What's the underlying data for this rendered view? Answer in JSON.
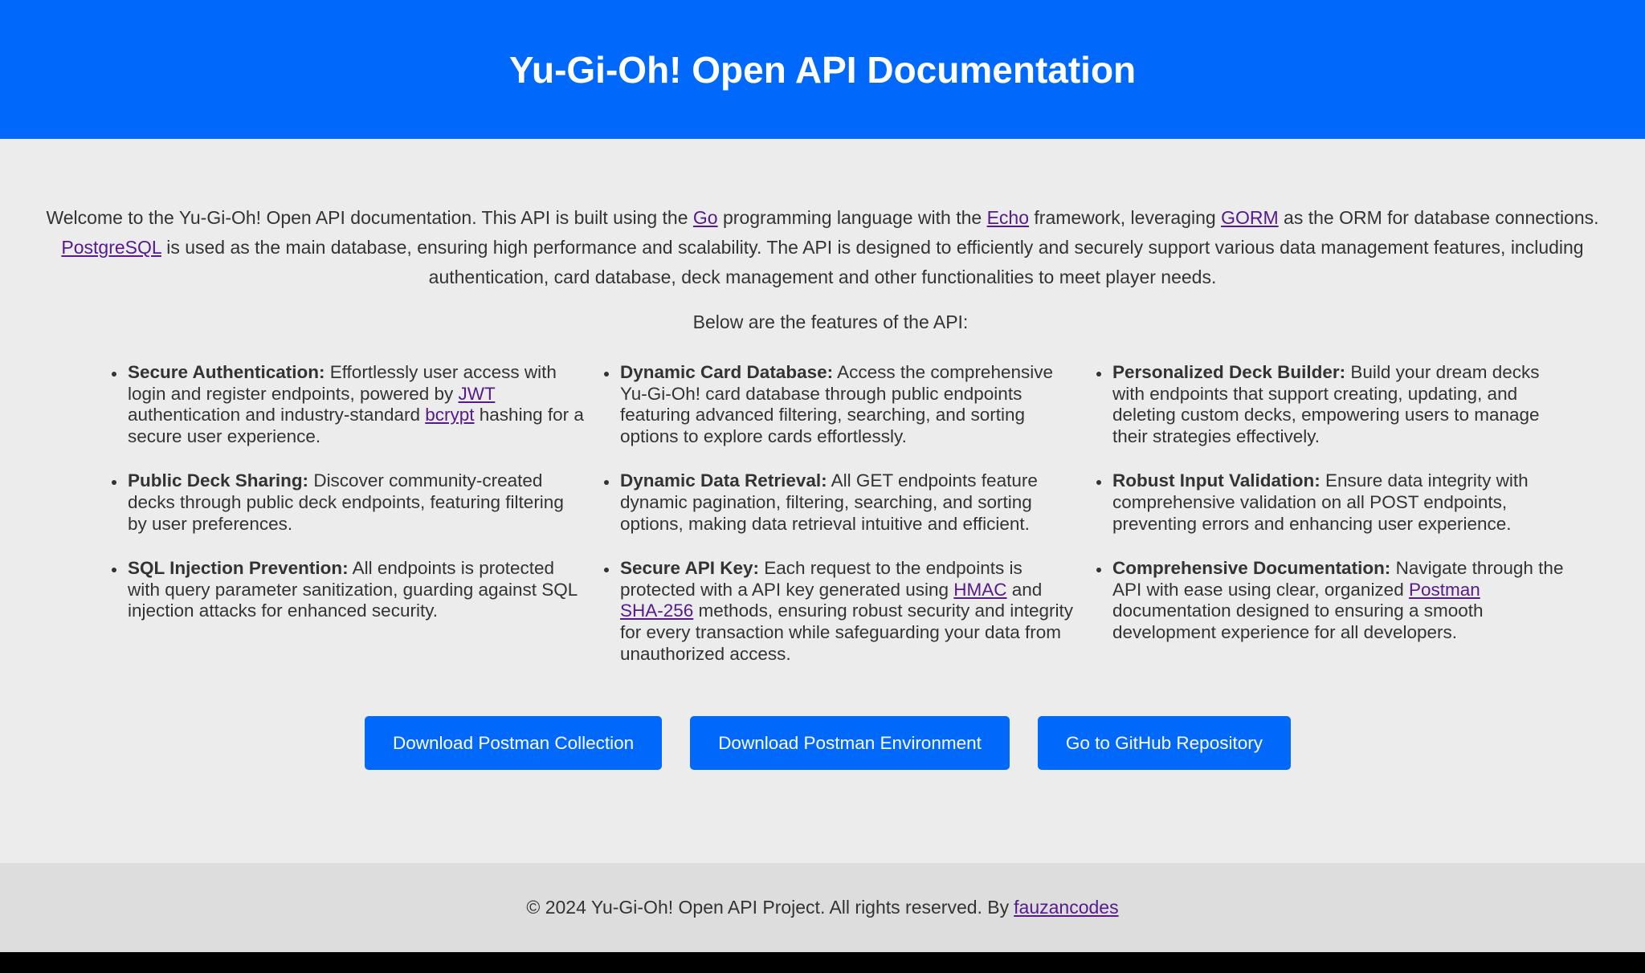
{
  "header": {
    "title": "Yu-Gi-Oh! Open API Documentation"
  },
  "intro": {
    "t1": "Welcome to the Yu-Gi-Oh! Open API documentation. This API is built using the ",
    "go_link": "Go",
    "t2": " programming language with the ",
    "echo_link": "Echo",
    "t3": " framework, leveraging ",
    "gorm_link": "GORM",
    "t4": " as the ORM for database connections. ",
    "postgres_link": "PostgreSQL",
    "t5": " is used as the main database, ensuring high performance and scalability. The API is designed to efficiently and securely support various data management features, including authentication, card database, deck management and other functionalities to meet player needs."
  },
  "features_title": "Below are the features of the API:",
  "features": {
    "col1": [
      {
        "title": "Secure Authentication:",
        "t1": " Effortlessly user access with login and register endpoints, powered by ",
        "link1": "JWT",
        "t2": " authentication and industry-standard ",
        "link2": "bcrypt",
        "t3": " hashing for a secure user experience."
      },
      {
        "title": "Public Deck Sharing:",
        "text": " Discover community-created decks through public deck endpoints, featuring filtering by user preferences."
      },
      {
        "title": "SQL Injection Prevention:",
        "text": " All endpoints is protected with query parameter sanitization, guarding against SQL injection attacks for enhanced security."
      }
    ],
    "col2": [
      {
        "title": "Dynamic Card Database:",
        "text": " Access the comprehensive Yu-Gi-Oh! card database through public endpoints featuring advanced filtering, searching, and sorting options to explore cards effortlessly."
      },
      {
        "title": "Dynamic Data Retrieval:",
        "text": " All GET endpoints feature dynamic pagination, filtering, searching, and sorting options, making data retrieval intuitive and efficient."
      },
      {
        "title": "Secure API Key:",
        "t1": " Each request to the endpoints is protected with a API key generated using ",
        "link1": "HMAC",
        "t2": " and ",
        "link2": "SHA-256",
        "t3": " methods, ensuring robust security and integrity for every transaction while safeguarding your data from unauthorized access."
      }
    ],
    "col3": [
      {
        "title": "Personalized Deck Builder:",
        "text": " Build your dream decks with endpoints that support creating, updating, and deleting custom decks, empowering users to manage their strategies effectively."
      },
      {
        "title": "Robust Input Validation:",
        "text": " Ensure data integrity with comprehensive validation on all POST endpoints, preventing errors and enhancing user experience."
      },
      {
        "title": "Comprehensive Documentation:",
        "t1": " Navigate through the API with ease using clear, organized ",
        "link1": "Postman",
        "t2": " documentation designed to ensuring a smooth development experience for all developers."
      }
    ]
  },
  "buttons": {
    "collection": "Download Postman Collection",
    "environment": "Download Postman Environment",
    "github": "Go to GitHub Repository"
  },
  "footer": {
    "text": "© 2024 Yu-Gi-Oh! Open API Project. All rights reserved. By",
    "link": "fauzancodes"
  },
  "colors": {
    "primary": "#0069fb",
    "background": "#ececec",
    "footer": "#dddddd",
    "link": "#551a8b"
  }
}
